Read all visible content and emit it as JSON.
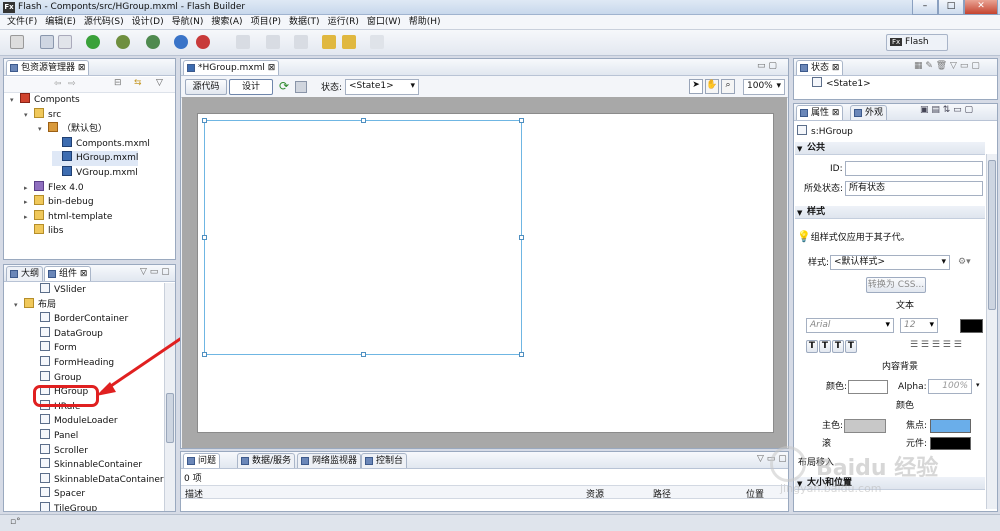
{
  "window": {
    "title": "Flash - Componts/src/HGroup.mxml - Flash Builder",
    "app_icon": "Fx",
    "min": "–",
    "max": "□",
    "close": "✕"
  },
  "menu": [
    "文件(F)",
    "编辑(E)",
    "源代码(S)",
    "设计(D)",
    "导航(N)",
    "搜索(A)",
    "项目(P)",
    "数据(T)",
    "运行(R)",
    "窗口(W)",
    "帮助(H)"
  ],
  "perspective": {
    "icon": "Fx",
    "label": "Flash"
  },
  "package_explorer": {
    "tab": "包资源管理器",
    "tree": [
      {
        "label": "Componts",
        "icon": "proj",
        "depth": 0,
        "arrow": "▾"
      },
      {
        "label": "src",
        "icon": "folder",
        "depth": 1,
        "arrow": "▾"
      },
      {
        "label": "（默认包）",
        "icon": "pkg",
        "depth": 2,
        "arrow": "▾"
      },
      {
        "label": "Componts.mxml",
        "icon": "mxml",
        "depth": 3,
        "arrow": ""
      },
      {
        "label": "HGroup.mxml",
        "icon": "mxml",
        "depth": 3,
        "arrow": "",
        "selected": true
      },
      {
        "label": "VGroup.mxml",
        "icon": "mxml",
        "depth": 3,
        "arrow": ""
      },
      {
        "label": "Flex 4.0",
        "icon": "lib",
        "depth": 1,
        "arrow": "▸"
      },
      {
        "label": "bin-debug",
        "icon": "folder",
        "depth": 1,
        "arrow": "▸"
      },
      {
        "label": "html-template",
        "icon": "folder",
        "depth": 1,
        "arrow": "▸"
      },
      {
        "label": "libs",
        "icon": "folder",
        "depth": 1,
        "arrow": ""
      }
    ]
  },
  "components_panel": {
    "tab_outline": "大纲",
    "tab_components": "组件",
    "group_label": "布局",
    "items": [
      "VSlider",
      "BorderContainer",
      "DataGroup",
      "Form",
      "FormHeading",
      "Group",
      "HGroup",
      "HRule",
      "ModuleLoader",
      "Panel",
      "Scroller",
      "SkinnableContainer",
      "SkinnableDataContainer",
      "Spacer",
      "TileGroup"
    ],
    "highlighted": "HGroup"
  },
  "editor": {
    "tab": "*HGroup.mxml",
    "source_btn": "源代码",
    "design_btn": "设计",
    "state_label": "状态:",
    "state_value": "<State1>",
    "zoom": "100%"
  },
  "bottom_panel": {
    "tabs": [
      "问题",
      "数据/服务",
      "网络监视器",
      "控制台"
    ],
    "count": "0 项",
    "columns": [
      "描述",
      "资源",
      "路径",
      "位置"
    ]
  },
  "states_panel": {
    "tab": "状态",
    "item": "<State1>"
  },
  "properties_panel": {
    "tab_props": "属性",
    "tab_appearance": "外观",
    "component": "s:HGroup",
    "sec_common": "公共",
    "id_label": "ID:",
    "id_value": "",
    "state_label": "所处状态:",
    "state_value": "所有状态",
    "sec_style": "样式",
    "style_hint": "组样式仅应用于其子代。",
    "style_label": "样式:",
    "style_value": "<默认样式>",
    "convert_css": "转换为 CSS...",
    "text_header": "文本",
    "font_name": "Arial",
    "font_size": "12",
    "text_btns": [
      "T",
      "T",
      "T",
      "T"
    ],
    "content_bg": "内容背景",
    "color_label": "颜色:",
    "alpha_label": "Alpha:",
    "alpha_value": "100%",
    "color_header": "颜色",
    "main_color_label": "主色:",
    "focus_label": "焦点:",
    "rollover_label": "滚",
    "symbol_label": "元件:",
    "layout_label": "布局移入",
    "size_pos": "大小和位置"
  },
  "colors": {
    "focus": "#6aaeea",
    "symbol": "#000000",
    "text_color": "#000000",
    "selection_border": "#6fb6e3",
    "highlight_red": "#e02020"
  },
  "watermark": {
    "line1": "Baidu 经验",
    "line2": "jingyan.baidu.com"
  }
}
